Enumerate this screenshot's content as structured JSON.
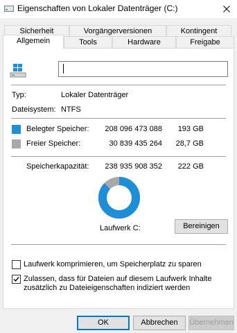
{
  "window": {
    "title": "Eigenschaften von Lokaler Datenträger (C:)"
  },
  "tabs": {
    "row1": [
      "Sicherheit",
      "Vorgängerversionen",
      "Kontingent"
    ],
    "row2": [
      "Allgemein",
      "Tools",
      "Hardware",
      "Freigabe"
    ],
    "active": "Allgemein"
  },
  "general": {
    "drive_name_value": "",
    "type_label": "Typ:",
    "type_value": "Lokaler Datenträger",
    "fs_label": "Dateisystem:",
    "fs_value": "NTFS",
    "used_label": "Belegter Speicher:",
    "used_bytes": "208 096 473 088",
    "used_gb": "193 GB",
    "free_label": "Freier Speicher:",
    "free_bytes": "30 839 435 264",
    "free_gb": "28,7 GB",
    "capacity_label": "Speicherkapazität:",
    "capacity_bytes": "238 935 908 352",
    "capacity_gb": "222 GB",
    "drive_label": "Laufwerk C:",
    "cleanup_button": "Bereinigen",
    "used_fraction": 0.871
  },
  "options": {
    "compress_label": "Laufwerk komprimieren, um Speicherplatz zu sparen",
    "compress_checked": false,
    "index_label_line1": "Zulassen, dass für Dateien auf diesem Laufwerk Inhalte",
    "index_label_line2": "zusätzlich zu Dateieigenschaften indiziert werden",
    "index_checked": true
  },
  "buttons": {
    "ok": "OK",
    "cancel": "Abbrechen",
    "apply": "Übernehmen"
  },
  "colors": {
    "used": "#1e8fd6",
    "free": "#a9a9a9",
    "accent": "#0078d7"
  },
  "icons": {
    "title": "drive-icon",
    "close": "close-icon",
    "drive": "windows-drive-icon",
    "check": "check-icon"
  }
}
